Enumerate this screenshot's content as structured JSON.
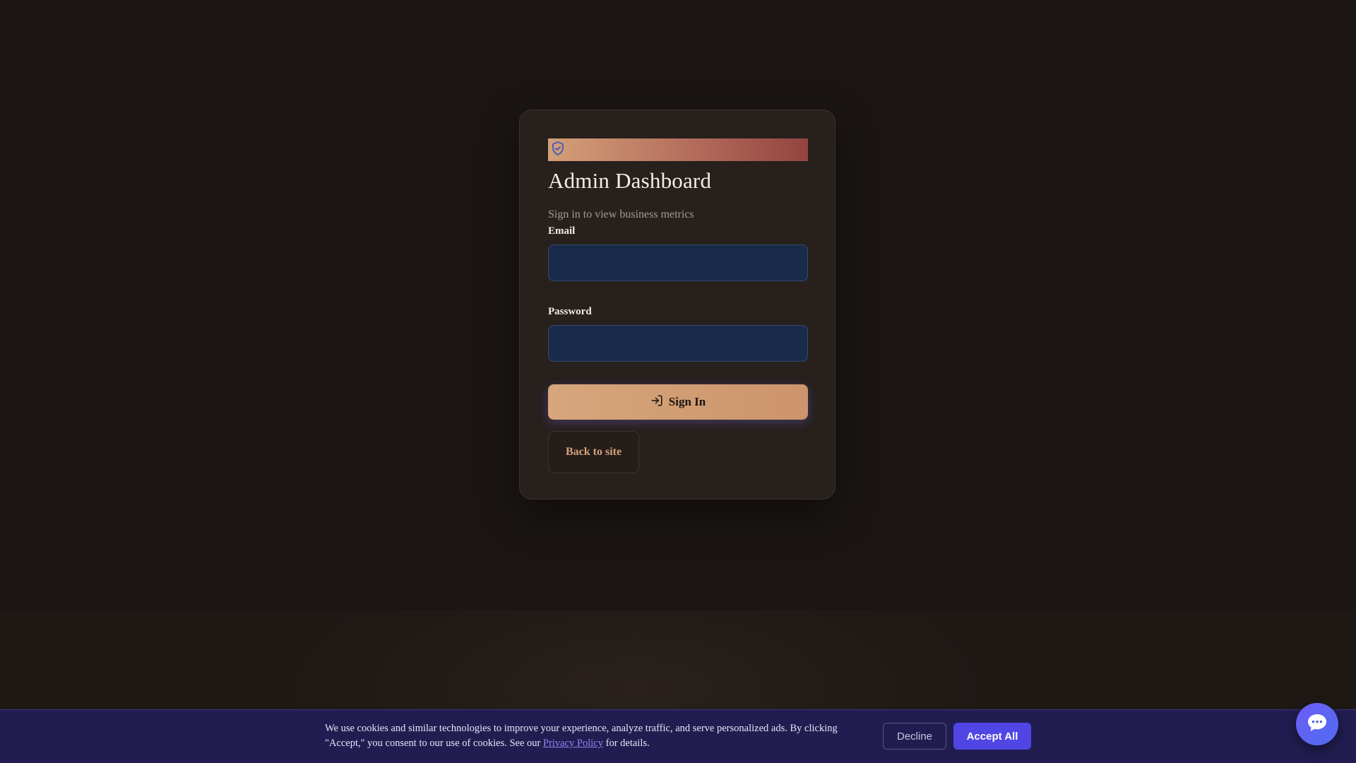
{
  "login": {
    "icon": "shield-check-icon",
    "title": "Admin Dashboard",
    "subtitle": "Sign in to view business metrics",
    "email_label": "Email",
    "email_value": "",
    "password_label": "Password",
    "password_value": "",
    "signin_label": "Sign In",
    "signin_icon": "log-in-icon",
    "back_label": "Back to site",
    "banner_colors": [
      "#d4a078",
      "#934440"
    ]
  },
  "cookie": {
    "text_before": "We use cookies and similar technologies to improve your experience, analyze traffic, and serve personalized ads. By clicking \"Accept,\" you consent to our use of cookies. See our ",
    "link_label": "Privacy Policy",
    "text_after": " for details.",
    "decline_label": "Decline",
    "accept_label": "Accept All",
    "accent": "#4f46e5"
  },
  "chat": {
    "icon": "chat-bubble-icon"
  }
}
